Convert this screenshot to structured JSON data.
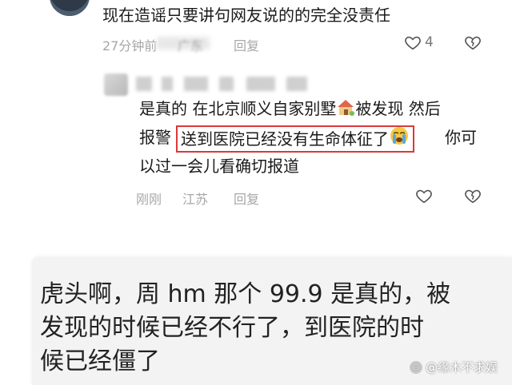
{
  "comment1": {
    "text": "现在造谣只要讲句网友说的的完全没责任",
    "time": "27分钟前",
    "location": "广东",
    "reply_label": "回复",
    "like_count": "4"
  },
  "comment2": {
    "line1": "是真的 在北京顺义自家别墅",
    "line1_end": "被发现 然后",
    "line2_start": "报警",
    "highlight": "送到医院已经没有生命体征了",
    "line2_end": "你可",
    "line3": "以过一会儿看确切报道",
    "time": "刚刚",
    "location": "江苏",
    "reply_label": "回复"
  },
  "card": {
    "line1": "虎头啊，周 hm 那个 99.9 是真的，被",
    "line2": "发现的时候已经不行了，到医院的时",
    "line3": "候已经僵了"
  },
  "watermark": "@缘木不求娱",
  "icons": {
    "like": "heart-outline-icon",
    "dislike": "broken-heart-icon",
    "house": "house-emoji-icon",
    "cry": "crying-face-emoji-icon"
  }
}
